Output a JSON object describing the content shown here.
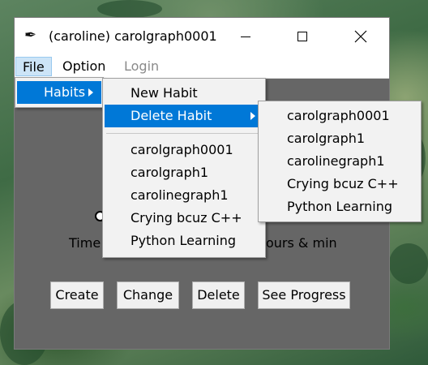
{
  "window": {
    "title": "(caroline) carolgraph0001",
    "icon": "feather-pen-icon"
  },
  "menubar": [
    "File",
    "Option",
    "Login"
  ],
  "file_menu": {
    "items": [
      {
        "label": "Habits",
        "has_submenu": true
      }
    ]
  },
  "habits_menu": {
    "items": [
      {
        "label": "New Habit"
      },
      {
        "label": "Delete Habit",
        "has_submenu": true
      },
      {
        "label": "carolgraph0001"
      },
      {
        "label": "carolgraph1"
      },
      {
        "label": "carolinegraph1"
      },
      {
        "label": "Crying bcuz C++"
      },
      {
        "label": "Python Learning"
      }
    ]
  },
  "delete_menu": {
    "items": [
      "carolgraph0001",
      "carolgraph1",
      "carolinegraph1",
      "Crying bcuz C++",
      "Python Learning"
    ]
  },
  "form": {
    "time_label": "Time",
    "time_unit_label": "ours & min"
  },
  "buttons": {
    "create": "Create",
    "change": "Change",
    "delete": "Delete",
    "progress": "See Progress"
  },
  "colors": {
    "highlight": "#0078d7",
    "client_bg": "#666666",
    "menu_bg": "#f2f2f2"
  }
}
